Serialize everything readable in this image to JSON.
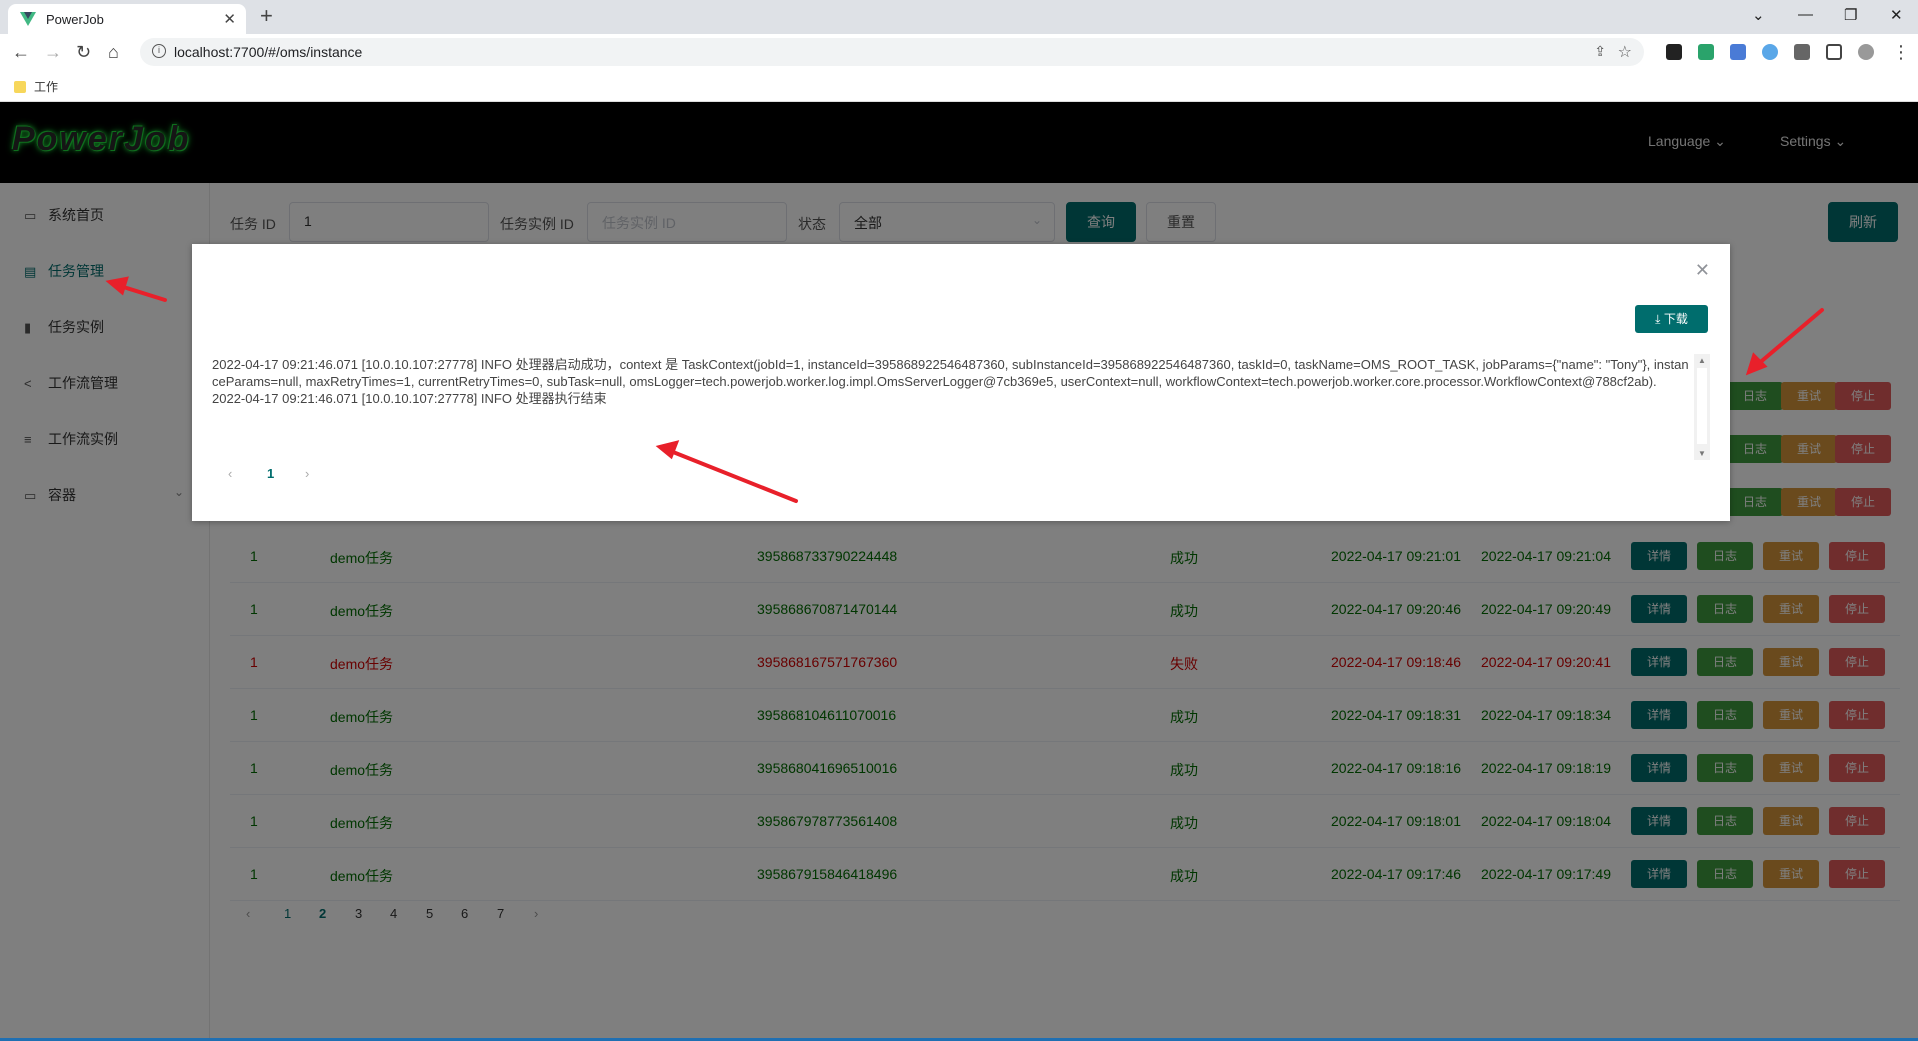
{
  "browser": {
    "tab_title": "PowerJob",
    "url": "localhost:7700/#/oms/instance",
    "bookmark": "工作"
  },
  "app": {
    "logo": "PowerJob",
    "language": "Language",
    "settings": "Settings"
  },
  "sidebar": {
    "items": [
      {
        "label": "系统首页",
        "icon": "monitor-icon"
      },
      {
        "label": "任务管理",
        "icon": "task-icon"
      },
      {
        "label": "任务实例",
        "icon": "bar-chart-icon"
      },
      {
        "label": "工作流管理",
        "icon": "share-icon"
      },
      {
        "label": "工作流实例",
        "icon": "sliders-icon"
      },
      {
        "label": "容器",
        "icon": "container-icon"
      }
    ]
  },
  "filters": {
    "job_id_label": "任务 ID",
    "job_id_value": "1",
    "instance_id_label": "任务实例 ID",
    "instance_id_placeholder": "任务实例 ID",
    "status_label": "状态",
    "status_value": "全部",
    "query": "查询",
    "reset": "重置",
    "refresh": "刷新"
  },
  "actions": {
    "detail": "详情",
    "log": "日志",
    "retry": "重试",
    "stop": "停止"
  },
  "rows": [
    {
      "job_id": "1",
      "name": "demo任务",
      "instance_id": "395868733790224448",
      "status": "成功",
      "start": "2022-04-17 09:21:01",
      "end": "2022-04-17 09:21:04"
    },
    {
      "job_id": "1",
      "name": "demo任务",
      "instance_id": "395868670871470144",
      "status": "成功",
      "start": "2022-04-17 09:20:46",
      "end": "2022-04-17 09:20:49"
    },
    {
      "job_id": "1",
      "name": "demo任务",
      "instance_id": "395868167571767360",
      "status": "失败",
      "start": "2022-04-17 09:18:46",
      "end": "2022-04-17 09:20:41"
    },
    {
      "job_id": "1",
      "name": "demo任务",
      "instance_id": "395868104611070016",
      "status": "成功",
      "start": "2022-04-17 09:18:31",
      "end": "2022-04-17 09:18:34"
    },
    {
      "job_id": "1",
      "name": "demo任务",
      "instance_id": "395868041696510016",
      "status": "成功",
      "start": "2022-04-17 09:18:16",
      "end": "2022-04-17 09:18:19"
    },
    {
      "job_id": "1",
      "name": "demo任务",
      "instance_id": "395867978773561408",
      "status": "成功",
      "start": "2022-04-17 09:18:01",
      "end": "2022-04-17 09:18:04"
    },
    {
      "job_id": "1",
      "name": "demo任务",
      "instance_id": "395867915846418496",
      "status": "成功",
      "start": "2022-04-17 09:17:46",
      "end": "2022-04-17 09:17:49"
    }
  ],
  "pagination": {
    "pages": [
      "1",
      "2",
      "3",
      "4",
      "5",
      "6",
      "7"
    ],
    "prev": "‹",
    "next": "›"
  },
  "modal": {
    "download": "下载",
    "log_line1": "2022-04-17 09:21:46.071 [10.0.10.107:27778] INFO 处理器启动成功，context 是 TaskContext(jobId=1, instanceId=395868922546487360, subInstanceId=395868922546487360, taskId=0, taskName=OMS_ROOT_TASK, jobParams={\"name\": \"Tony\"}, instanceParams=null, maxRetryTimes=1, currentRetryTimes=0, subTask=null, omsLogger=tech.powerjob.worker.log.impl.OmsServerLogger@7cb369e5, userContext=null, workflowContext=tech.powerjob.worker.core.processor.WorkflowContext@788cf2ab).",
    "log_line2": "2022-04-17 09:21:46.071 [10.0.10.107:27778] INFO 处理器执行结束",
    "page": "1"
  },
  "colors": {
    "primary": "#006d6d",
    "success": "#006d00",
    "danger": "#d00000",
    "log_btn": "#3f9b3f",
    "retry_btn": "#d4953a",
    "stop_btn": "#e05a5a"
  }
}
